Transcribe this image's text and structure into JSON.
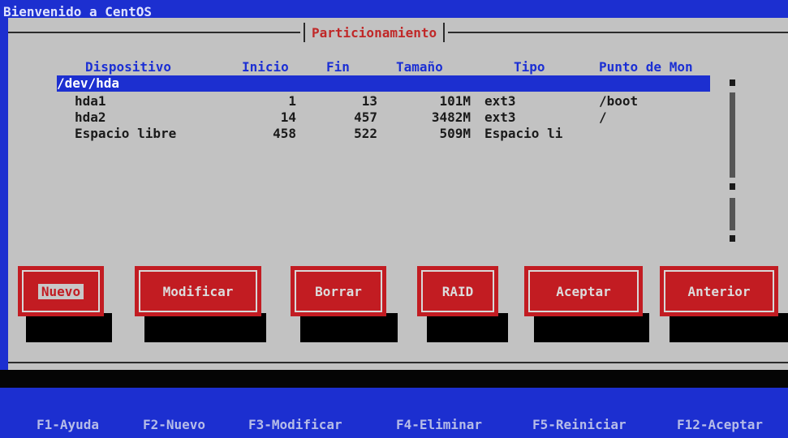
{
  "window": {
    "top_title": "Bienvenido a CentOS",
    "dialog_title": "Particionamiento"
  },
  "table": {
    "headers": [
      "Dispositivo",
      "Inicio",
      "Fin",
      "Tamaño",
      "Tipo",
      "Punto de Mon"
    ],
    "group": "/dev/hda",
    "rows": [
      {
        "device": "hda1",
        "start": "1",
        "end": "13",
        "size": "101M",
        "type": "ext3",
        "mount": "/boot"
      },
      {
        "device": "hda2",
        "start": "14",
        "end": "457",
        "size": "3482M",
        "type": "ext3",
        "mount": "/"
      },
      {
        "device": "Espacio libre",
        "start": "458",
        "end": "522",
        "size": "509M",
        "type": "Espacio li",
        "mount": ""
      }
    ]
  },
  "buttons": [
    "Nuevo",
    "Modificar",
    "Borrar",
    "RAID",
    "Aceptar",
    "Anterior"
  ],
  "function_keys": [
    "F1-Ayuda",
    "F2-Nuevo",
    "F3-Modificar",
    "F4-Eliminar",
    "F5-Reiniciar",
    "F12-Aceptar"
  ],
  "colors": {
    "background": "#1c2fd0",
    "window": "#c2c2c2",
    "button": "#c21c22",
    "header_text": "#1b2fd4",
    "title_text": "#c02828"
  }
}
